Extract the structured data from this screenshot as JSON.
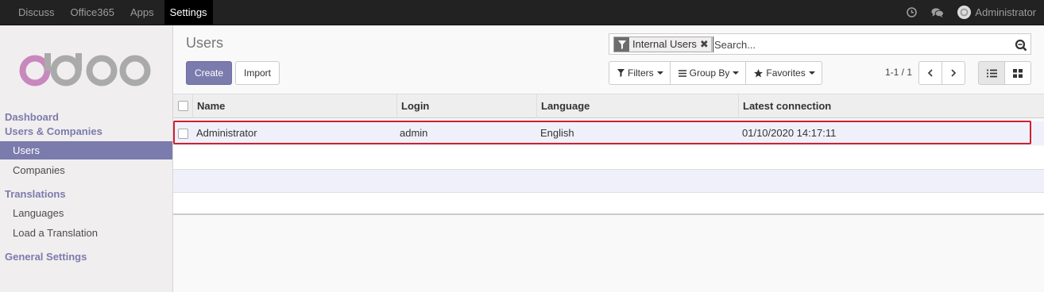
{
  "topbar": {
    "menu": [
      {
        "label": "Discuss"
      },
      {
        "label": "Office365"
      },
      {
        "label": "Apps"
      },
      {
        "label": "Settings"
      }
    ],
    "user": "Administrator",
    "icons": [
      "clock-icon",
      "chat-icon",
      "avatar"
    ]
  },
  "sidebar": {
    "dashboard": "Dashboard",
    "users_companies": "Users & Companies",
    "users": "Users",
    "companies": "Companies",
    "translations": "Translations",
    "languages": "Languages",
    "load_translation": "Load a Translation",
    "general_settings": "General Settings"
  },
  "control_panel": {
    "title": "Users",
    "create_label": "Create",
    "import_label": "Import",
    "facet_label": "Internal Users",
    "search_placeholder": "Search...",
    "filters_label": "Filters",
    "groupby_label": "Group By",
    "favorites_label": "Favorites",
    "pager": "1-1 / 1"
  },
  "table": {
    "headers": {
      "name": "Name",
      "login": "Login",
      "language": "Language",
      "latest_connection": "Latest connection"
    },
    "rows": [
      {
        "name": "Administrator",
        "login": "admin",
        "language": "English",
        "latest_connection": "01/10/2020 14:17:11"
      }
    ]
  },
  "colors": {
    "brand": "#7c7bad",
    "topbar": "#222222",
    "highlight_border": "#d0202e"
  }
}
